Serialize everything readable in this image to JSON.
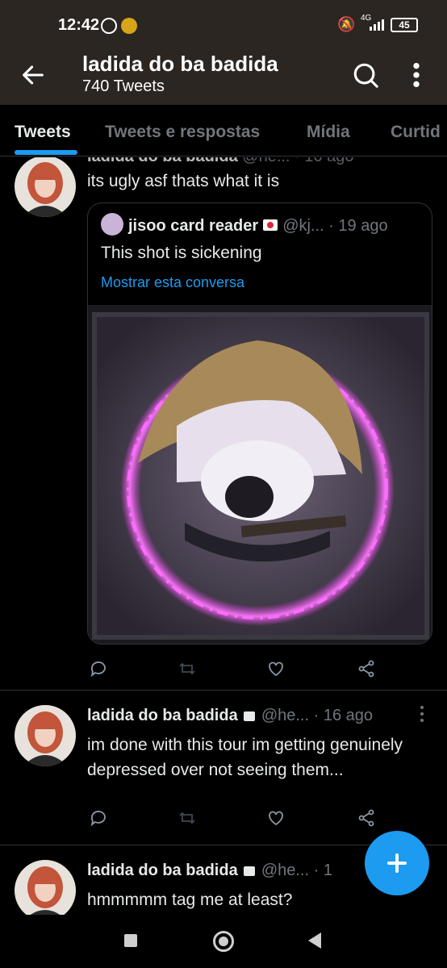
{
  "status_bar": {
    "time": "12:42",
    "network": "4G",
    "battery": "45"
  },
  "header": {
    "title": "ladida do ba badida",
    "subtitle": "740 Tweets"
  },
  "tabs": [
    {
      "label": "Tweets",
      "active": true
    },
    {
      "label": "Tweets e respostas",
      "active": false
    },
    {
      "label": "Mídia",
      "active": false
    },
    {
      "label": "Curtid",
      "active": false
    }
  ],
  "tweets": [
    {
      "name": "ladida do ba badida",
      "handle": "@he...",
      "time": "· 16 ago",
      "text": "its ugly asf thats what it is",
      "quote": {
        "name": "jisoo card reader",
        "handle": "@kj...",
        "time": "· 19 ago",
        "text": "This shot is sickening",
        "link": "Mostrar esta conversa"
      }
    },
    {
      "name": "ladida do ba badida",
      "handle": "@he...",
      "time": "· 16 ago",
      "text": "im done with this tour im getting genuinely depressed over not seeing them..."
    },
    {
      "name": "ladida do ba badida",
      "handle": "@he...",
      "time": "· 1",
      "text": "hmmmmm tag me at least?"
    }
  ],
  "colors": {
    "accent": "#1d9bf0",
    "header_bg": "#2b2621",
    "muted_text": "#71767b"
  }
}
